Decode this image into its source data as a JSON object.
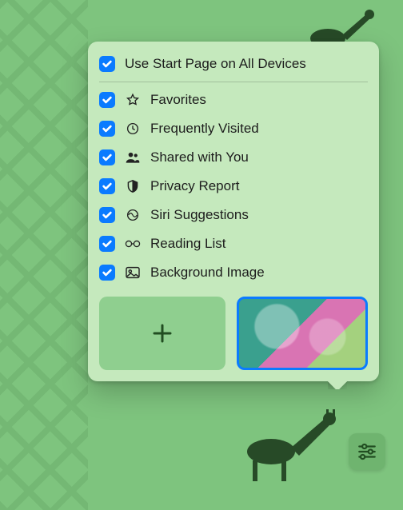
{
  "popover": {
    "header": {
      "label": "Use Start Page on All Devices",
      "checked": true
    },
    "items": [
      {
        "icon": "star-icon",
        "label": "Favorites",
        "checked": true
      },
      {
        "icon": "clock-icon",
        "label": "Frequently Visited",
        "checked": true
      },
      {
        "icon": "people-icon",
        "label": "Shared with You",
        "checked": true
      },
      {
        "icon": "shield-icon",
        "label": "Privacy Report",
        "checked": true
      },
      {
        "icon": "siri-icon",
        "label": "Siri Suggestions",
        "checked": true
      },
      {
        "icon": "glasses-icon",
        "label": "Reading List",
        "checked": true
      },
      {
        "icon": "image-icon",
        "label": "Background Image",
        "checked": true
      }
    ],
    "thumbnails": {
      "add": "add-background",
      "selected": "butterfly-background"
    }
  },
  "controls": {
    "settings_button": "customize-start-page"
  }
}
